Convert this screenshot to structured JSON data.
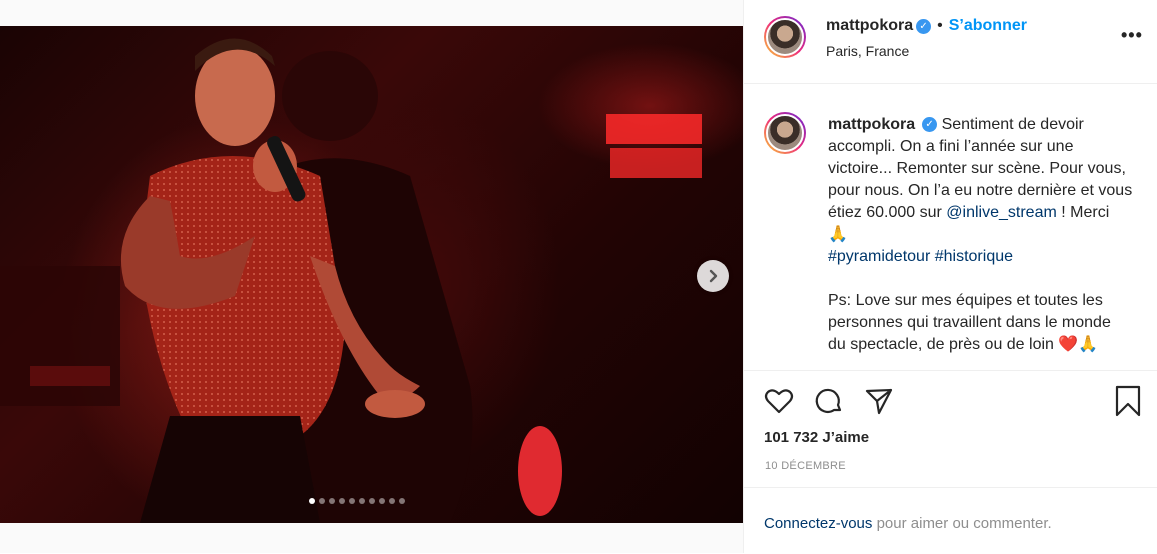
{
  "post": {
    "username": "mattpokora",
    "verified_icon": "verified-badge-icon",
    "separator": "•",
    "follow_label": "S’abonner",
    "location": "Paris, France",
    "more_label": "•••"
  },
  "caption": {
    "username": "mattpokora",
    "line1": "Sentiment de devoir accompli. On a fini l’année sur une victoire... Remonter sur scène. Pour vous, pour nous. On l’a eu notre dernière et vous étiez 60.000 sur ",
    "mention": "@inlive_stream",
    "after_mention": " ! Merci 🙏",
    "hashtag1": "#pyramidetour",
    "hashtag2": "#historique",
    "ps": "Ps: Love sur mes équipes et toutes les personnes qui travaillent dans le monde du spectacle, de près ou de loin ❤️🙏"
  },
  "stats": {
    "likes": "101 732 J’aime",
    "date": "10 DÉCEMBRE"
  },
  "footer": {
    "login_link": "Connectez-vous",
    "login_rest": " pour aimer ou commenter."
  },
  "carousel": {
    "total_slides": 10,
    "active_slide": 1
  },
  "colors": {
    "accent": "#0095f6",
    "link": "#00376b",
    "verified": "#3897f0",
    "muted": "#8e8e8e"
  }
}
